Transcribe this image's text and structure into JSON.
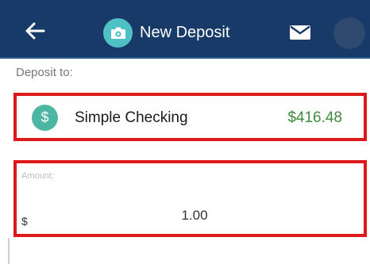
{
  "header": {
    "back_icon": "back-arrow-icon",
    "title_icon": "camera-icon",
    "title": "New Deposit",
    "mail_icon": "mail-icon",
    "colors": {
      "bar": "#173a68",
      "badge": "#4fc1c4"
    }
  },
  "deposit_to": {
    "label": "Deposit to:",
    "account": {
      "icon": "dollar-icon",
      "icon_text": "$",
      "name": "Simple Checking",
      "balance": "$416.48",
      "balance_color": "#3f8c3c"
    }
  },
  "amount": {
    "label": "Amount:",
    "currency": "$",
    "value": "1.00"
  },
  "highlight_color": "#dd1a1a"
}
